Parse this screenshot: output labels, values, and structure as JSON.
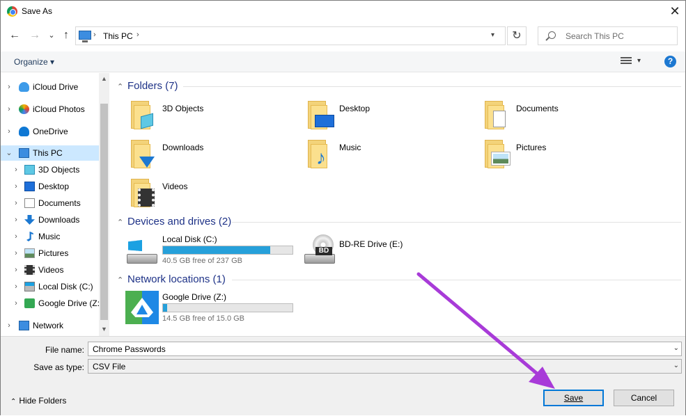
{
  "window": {
    "title": "Save As",
    "close_glyph": "✕"
  },
  "nav": {
    "back_glyph": "←",
    "forward_glyph": "→",
    "recent_glyph": "⌄",
    "up_glyph": "↑",
    "breadcrumb": [
      "This PC"
    ],
    "sep_glyph": "›",
    "refresh_glyph": "↻",
    "search_placeholder": "Search This PC"
  },
  "toolbar": {
    "organize_label": "Organize ▾",
    "help_glyph": "?"
  },
  "sidebar": {
    "items": [
      {
        "label": "iCloud Drive",
        "icon": "cloud-icon",
        "level": 0
      },
      {
        "label": "iCloud Photos",
        "icon": "photos-icon",
        "level": 0
      },
      {
        "label": "OneDrive",
        "icon": "onedrive-icon",
        "level": 0
      },
      {
        "label": "This PC",
        "icon": "pc-icon",
        "level": 0,
        "selected": true
      },
      {
        "label": "3D Objects",
        "icon": "cube-icon",
        "level": 1
      },
      {
        "label": "Desktop",
        "icon": "desktop-icon",
        "level": 1
      },
      {
        "label": "Documents",
        "icon": "documents-icon",
        "level": 1
      },
      {
        "label": "Downloads",
        "icon": "download-icon",
        "level": 1
      },
      {
        "label": "Music",
        "icon": "music-icon",
        "level": 1
      },
      {
        "label": "Pictures",
        "icon": "pictures-icon",
        "level": 1
      },
      {
        "label": "Videos",
        "icon": "videos-icon",
        "level": 1
      },
      {
        "label": "Local Disk (C:)",
        "icon": "disk-icon",
        "level": 1
      },
      {
        "label": "Google Drive (Z:",
        "icon": "gdrive-icon",
        "level": 1
      },
      {
        "label": "Network",
        "icon": "network-icon",
        "level": 0
      }
    ]
  },
  "main": {
    "folders_header": "Folders (7)",
    "folders": [
      "3D Objects",
      "Desktop",
      "Documents",
      "Downloads",
      "Music",
      "Pictures",
      "Videos"
    ],
    "devices_header": "Devices and drives (2)",
    "drives": [
      {
        "label": "Local Disk (C:)",
        "free": "40.5 GB free of 237 GB",
        "used_fraction": 0.83
      }
    ],
    "bd_drive": "BD-RE Drive (E:)",
    "bd_text": "BD",
    "network_header": "Network locations (1)",
    "network": [
      {
        "label": "Google Drive (Z:)",
        "free": "14.5 GB free of 15.0 GB",
        "used_fraction": 0.03
      }
    ]
  },
  "bottom": {
    "filename_label": "File name:",
    "filename_value": "Chrome Passwords",
    "savetype_label": "Save as type:",
    "savetype_value": "CSV File",
    "hide_folders": "Hide Folders",
    "save_label": "Save",
    "cancel_label": "Cancel"
  },
  "colors": {
    "accent": "#0078d7",
    "selection": "#cce8ff",
    "annotation_arrow": "#a83bd8"
  }
}
